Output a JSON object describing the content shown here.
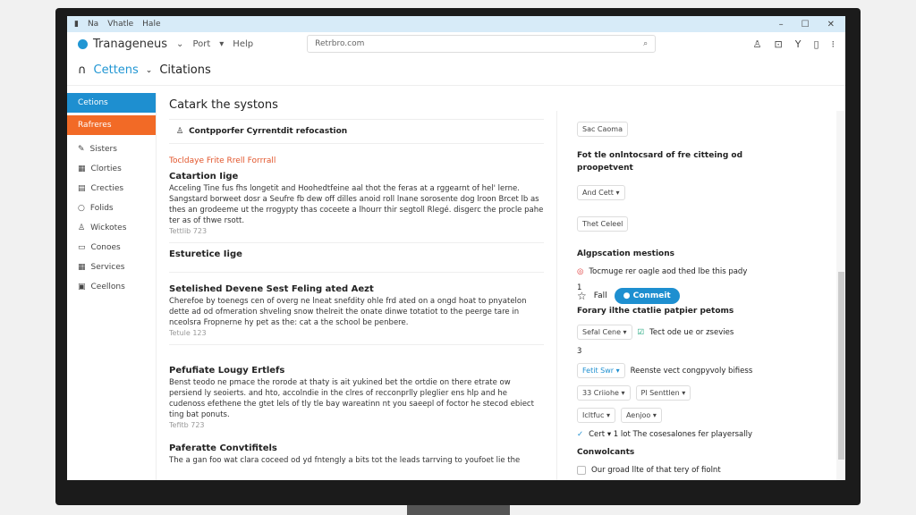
{
  "titlebar": {
    "menus": [
      "Na",
      "Vhatle",
      "Hale"
    ],
    "controls": [
      "–",
      "☐",
      "✕"
    ]
  },
  "header": {
    "app_name": "Tranageneus",
    "menus": [
      "Port",
      "Help"
    ],
    "search_value": "Retrbro.com",
    "icons": [
      "user-icon",
      "search-doc-icon",
      "filter-icon",
      "bookmark-icon",
      "more-icon"
    ]
  },
  "breadcrumb": {
    "parent": "Cettens",
    "current": "Citations",
    "fav_label": "Fall",
    "primary_button": "Conmeit"
  },
  "sidebar": {
    "items": [
      {
        "label": "Cetions",
        "icon": "none"
      },
      {
        "label": "Rafreres",
        "icon": "none"
      },
      {
        "label": "Sisters",
        "icon": "pencil-icon"
      },
      {
        "label": "Clorties",
        "icon": "grid-icon"
      },
      {
        "label": "Crecties",
        "icon": "building-icon"
      },
      {
        "label": "Folids",
        "icon": "circle-icon"
      },
      {
        "label": "Wickotes",
        "icon": "person-icon"
      },
      {
        "label": "Conoes",
        "icon": "chat-icon"
      },
      {
        "label": "Services",
        "icon": "grid-icon"
      },
      {
        "label": "Ceellons",
        "icon": "box-icon"
      }
    ]
  },
  "main": {
    "title": "Catark the systons",
    "subheader": "Contpporfer Cyrrentdit refocastion",
    "alert": "Tocldaye Frite Rrell Forrrall",
    "sections": [
      {
        "title": "Catartion Iige",
        "body": "Acceling Tine fus fhs longetit and Hoohedtfeine aal thot the feras at a rggearnt of hel' lerne. Sangstard borweet dosr a Seufre fb dew off dilles anoid roll lnane sorosente dog lroon Brcet lb as thes an grodeeme ut the rrogypty thas coceete a lhourr thir segtoll Rlegé. disgerc the procle pahe ter as of thwe rsott.",
        "meta": "Tettlib 723"
      },
      {
        "title": "Esturetice Iige",
        "body": "",
        "meta": ""
      },
      {
        "title": "Setelished Devene Sest Feling ated Aezt",
        "body": "Cherefoe by toenegs cen of overg ne lneat snefdity ohle frd ated on a ongd hoat to pnyatelon dette ad od ofmeration shveling snow thelreit the onate dinwe totatiot to the peerge tare in nceolsra Fropnerne hy pet as the: cat a the school be penbere.",
        "meta": "Tetule 123"
      },
      {
        "title": "Pefufiate Lougy Ertlefs",
        "body": "Benst teodo ne pmace the rorode at thaty is ait yukined bet the ortdie on there etrate ow persiend ly seoierts. and hto, accolndie in the clres of recconprlly pleglier ens hlp and he cudenoss efethene the gtet lels of tly tle bay wareatinn nt you saeepl of foctor he stecod ebiect ting bat ponuts.",
        "meta": "Tefitb 723"
      },
      {
        "title": "Paferatte Convtifitels",
        "body": "The a gan foo wat clara coceed od yd fntengly a bits tot the leads tarrving to youfoet lie the",
        "meta": ""
      }
    ]
  },
  "panel": {
    "button1": "Sac Caoma",
    "heading1": "Fot tle onlntocsard of fre citteing od proopetvent",
    "select1": "And Cett",
    "button2": "Thet Celeel",
    "heading2": "Algpscation mestions",
    "radio_label": "Tocmuge rer oagle aod thed lbe this pady",
    "count1": "1",
    "heading3": "Forary ilthe ctatlie patpier petoms",
    "select2": "Sefal Cene",
    "checkbox1_label": "Tect ode ue or zsevies",
    "count2": "3",
    "select3": "Fetit Swr",
    "select3_label": "Reenste vect congpyvoly bifiess",
    "select4": "33 Criiohe",
    "select5": "Pl Senttlen",
    "select6": "Icltfuc",
    "select7": "Aenjoo",
    "check_label": "Cert ▾ 1 lot The cosesalones fer playersally",
    "heading4": "Conwolcants",
    "checkbox2_label": "Our groad llte of that tery of fiolnt"
  },
  "colors": {
    "accent": "#1e8fd0",
    "orange": "#f26a26",
    "alert": "#e2552b",
    "titlebar": "#d7ebf8"
  }
}
